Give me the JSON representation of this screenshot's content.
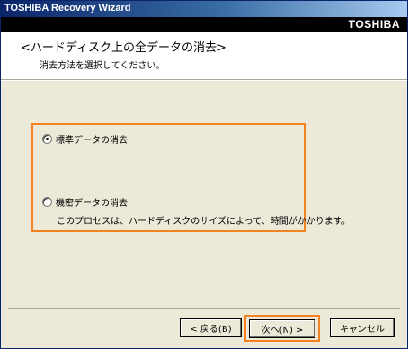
{
  "window": {
    "title": "TOSHIBA Recovery Wizard",
    "brand": "TOSHIBA"
  },
  "header": {
    "heading": "<ハードディスク上の全データの消去>",
    "subheading": "消去方法を選択してください。"
  },
  "options": [
    {
      "label": "標準データの消去",
      "selected": true
    },
    {
      "label": "機密データの消去",
      "selected": false,
      "note": "このプロセスは、ハードディスクのサイズによって、時間がかかります。"
    }
  ],
  "buttons": {
    "back": "< 戻る(B)",
    "next": "次へ(N) >",
    "cancel": "キャンセル"
  },
  "colors": {
    "highlight": "#f58220",
    "title_bar": "#0a246a"
  }
}
